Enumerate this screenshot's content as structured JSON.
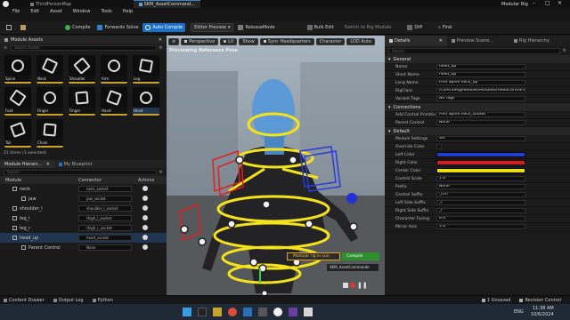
{
  "title_bar": {
    "doc_tab_1": "ThirdPersonMap",
    "doc_tab_2": "SKM_AssetCommand...",
    "project_name": "Modular Rig"
  },
  "menu": [
    "File",
    "Edit",
    "Asset",
    "Window",
    "Tools",
    "Help"
  ],
  "toolbar": {
    "compile": "Compile",
    "forwards_solve": "Forwards Solve",
    "auto_compile": "Auto Compile",
    "editor_preview": "Editor Preview",
    "release_mode": "ReleaseMode",
    "bulk_edit": "Bulk Edit",
    "switch_to_rig_module": "Switch to Rig Module",
    "diff": "Diff",
    "find": "Find"
  },
  "module_assets": {
    "tab_label": "Module Assets",
    "search_placeholder": "Search Assets",
    "items": [
      {
        "name": "Spine",
        "icon": "spine-icon",
        "selected": false
      },
      {
        "name": "Neck",
        "icon": "neck-icon",
        "selected": false
      },
      {
        "name": "Shoulder",
        "icon": "shoulder-icon",
        "selected": false
      },
      {
        "name": "Arm",
        "icon": "arm-icon",
        "selected": false
      },
      {
        "name": "Leg",
        "icon": "leg-icon",
        "selected": false
      },
      {
        "name": "Foot",
        "icon": "foot-icon",
        "selected": false
      },
      {
        "name": "Finger",
        "icon": "finger-icon",
        "selected": false
      },
      {
        "name": "Finger",
        "icon": "finger-icon",
        "selected": false
      },
      {
        "name": "Hand",
        "icon": "hand-icon",
        "selected": false
      },
      {
        "name": "Head",
        "icon": "head-icon",
        "selected": true
      },
      {
        "name": "Tail",
        "icon": "tail-icon",
        "selected": false
      },
      {
        "name": "Chain",
        "icon": "chain-icon",
        "selected": false
      }
    ],
    "count_text": "21 items (1 selected)"
  },
  "hierarchy": {
    "tab_module": "Module Hierarc...",
    "tab_blueprint": "My Blueprint",
    "search_placeholder": "Search",
    "columns": [
      "Module",
      "Connector",
      "Actions"
    ],
    "rows": [
      {
        "name": "neck",
        "connector": "neck_socket"
      },
      {
        "name": "jaw",
        "connector": "jaw_socket"
      },
      {
        "name": "shoulder_l",
        "connector": "shoulder_l_socket"
      },
      {
        "name": "leg_l",
        "connector": "thigh_l_socket"
      },
      {
        "name": "leg_r",
        "connector": "thigh_r_socket"
      },
      {
        "name": "head_up",
        "connector": "head_socket"
      },
      {
        "name": "Parent Control",
        "connector": "None"
      }
    ]
  },
  "viewport": {
    "perspective": "Perspective",
    "lit": "Lit",
    "show": "Show",
    "sync_headquarters": "Sync Headquarters",
    "character": "Character",
    "lod_auto": "LOD Auto",
    "preview_label": "Previewing Reference Pose",
    "overlay_1": "Modular rig in sun",
    "overlay_2": "Compile",
    "overlay_3": "SKM_AssetCommande"
  },
  "details": {
    "tab_details": "Details",
    "tab_preview": "Preview Scene...",
    "tab_rig": "Rig Hierarchy",
    "search_placeholder": "Search",
    "section_general": "General",
    "general": [
      {
        "label": "Name",
        "value": "head_up"
      },
      {
        "label": "Short Name",
        "value": "head_up"
      },
      {
        "label": "Long Name",
        "value": "Find Spine neck_up"
      },
      {
        "label": "RigClass",
        "value": "/ControlRigModules/Modules/HeadControl.HeadControl_C"
      },
      {
        "label": "Variant Tags",
        "value": "No Tags"
      }
    ],
    "section_connections": "Connections",
    "connections": [
      {
        "label": "Add Control Primitiv",
        "value": "Find Spine neck_socket"
      },
      {
        "label": "Parent Control",
        "value": "None"
      }
    ],
    "section_default": "Default",
    "default": [
      {
        "label": "Module Settings",
        "value": "Vis"
      },
      {
        "label": "Override Color",
        "value": ""
      },
      {
        "label": "Left Color",
        "value": "",
        "swatch": "#1f3fd0"
      },
      {
        "label": "Right Color",
        "value": "",
        "swatch": "#e01818"
      },
      {
        "label": "Center Color",
        "value": "",
        "swatch": "#e8e010"
      },
      {
        "label": "Control Scale",
        "value": "1.0"
      },
      {
        "label": "Prefix",
        "value": "None"
      },
      {
        "label": "Control Suffix",
        "value": "_ctrl"
      },
      {
        "label": "Left Side Suffix",
        "value": "_l"
      },
      {
        "label": "Right Side Suffix",
        "value": "_r"
      },
      {
        "label": "Character Facing",
        "value": "0.0"
      },
      {
        "label": "Mirror Axis",
        "value": "1.0"
      }
    ]
  },
  "status_bar": {
    "content_drawer": "Content Drawer",
    "output_log": "Output Log",
    "python": "Python",
    "unsaved": "1 Unsaved",
    "revision_control": "Revision Control"
  },
  "taskbar": {
    "time": "11:38 AM",
    "date": "10/6/2024",
    "lang": "ENG"
  },
  "colors": {
    "accent": "#1c6fc4",
    "yellow_ctrl": "#f4e21a",
    "red_ctrl": "#e02020",
    "blue_ctrl": "#2a3bdc",
    "skin": "#5b9ad6"
  }
}
